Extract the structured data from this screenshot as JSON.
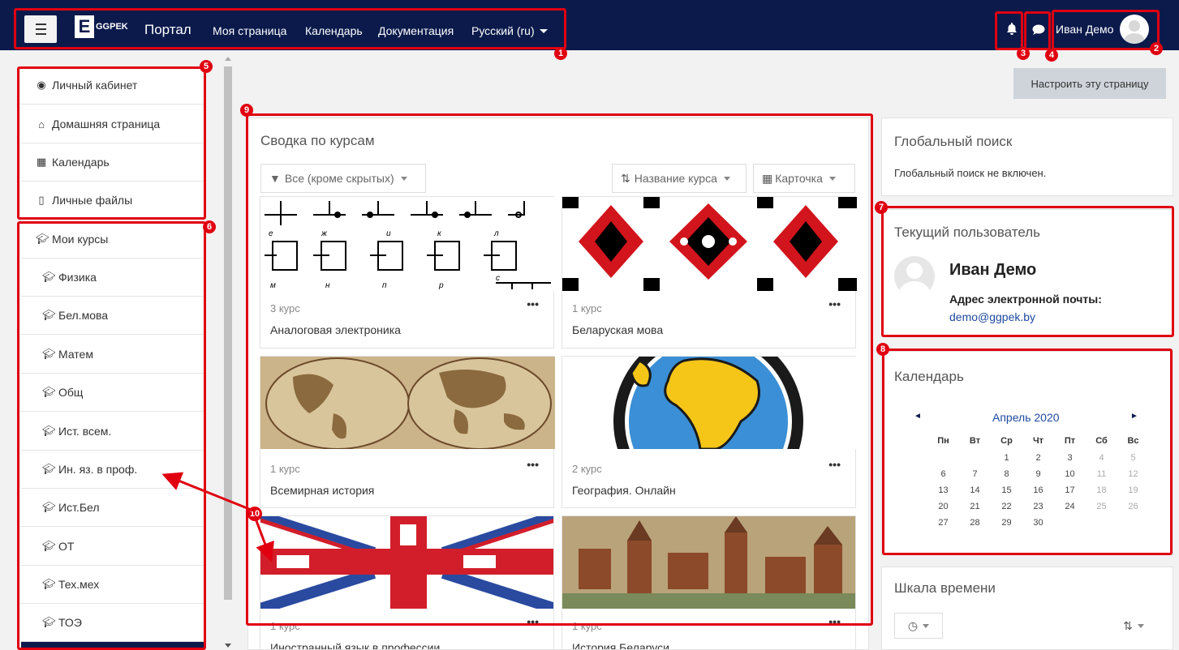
{
  "navbar": {
    "brand": "Портал",
    "logo_text": "GGPEK",
    "nav_items": [
      "Моя страница",
      "Календарь",
      "Документация"
    ],
    "lang": "Русский (ru)",
    "user_name": "Иван Демо"
  },
  "drawer": {
    "items": [
      {
        "label": "Личный кабинет",
        "icon": "dashboard-icon"
      },
      {
        "label": "Домашняя страница",
        "icon": "home-icon"
      },
      {
        "label": "Календарь",
        "icon": "calendar-icon"
      },
      {
        "label": "Личные файлы",
        "icon": "file-icon"
      },
      {
        "label": "Мои курсы",
        "icon": "graduation-cap-icon"
      },
      {
        "label": "Физика",
        "icon": "graduation-cap-icon"
      },
      {
        "label": "Бел.мова",
        "icon": "graduation-cap-icon"
      },
      {
        "label": "Матем",
        "icon": "graduation-cap-icon"
      },
      {
        "label": "Общ",
        "icon": "graduation-cap-icon"
      },
      {
        "label": "Ист. всем.",
        "icon": "graduation-cap-icon"
      },
      {
        "label": "Ин. яз. в проф.",
        "icon": "graduation-cap-icon"
      },
      {
        "label": "Ист.Бел",
        "icon": "graduation-cap-icon"
      },
      {
        "label": "ОТ",
        "icon": "graduation-cap-icon"
      },
      {
        "label": "Тех.мех",
        "icon": "graduation-cap-icon"
      },
      {
        "label": "ТОЭ",
        "icon": "graduation-cap-icon"
      }
    ]
  },
  "customize_button": "Настроить эту страницу",
  "overview": {
    "title": "Сводка по курсам",
    "filter": "Все (кроме скрытых)",
    "sort": "Название курса",
    "view": "Карточка",
    "courses": [
      {
        "level": "3 курс",
        "name": "Аналоговая электроника"
      },
      {
        "level": "1 курс",
        "name": "Беларуская мова"
      },
      {
        "level": "1 курс",
        "name": "Всемирная история"
      },
      {
        "level": "2 курс",
        "name": "География. Онлайн"
      },
      {
        "level": "1 курс",
        "name": "Иностранный язык в профессии"
      },
      {
        "level": "1 курс",
        "name": "История Беларуси"
      }
    ]
  },
  "search_block": {
    "title": "Глобальный поиск",
    "text": "Глобальный поиск не включен."
  },
  "user_block": {
    "title": "Текущий пользователь",
    "name": "Иван Демо",
    "email_label": "Адрес электронной почты:",
    "email": "demo@ggpek.by"
  },
  "calendar_block": {
    "title": "Календарь",
    "month": "Апрель 2020",
    "prev": "◄",
    "next": "►",
    "days": [
      "Пн",
      "Вт",
      "Ср",
      "Чт",
      "Пт",
      "Сб",
      "Вс"
    ],
    "weeks": [
      [
        "",
        "",
        "1",
        "2",
        "3",
        "4",
        "5"
      ],
      [
        "6",
        "7",
        "8",
        "9",
        "10",
        "11",
        "12"
      ],
      [
        "13",
        "14",
        "15",
        "16",
        "17",
        "18",
        "19"
      ],
      [
        "20",
        "21",
        "22",
        "23",
        "24",
        "25",
        "26"
      ],
      [
        "27",
        "28",
        "29",
        "30",
        "",
        "",
        ""
      ]
    ]
  },
  "timeline_block": {
    "title": "Шкала времени"
  },
  "annotations": [
    "1",
    "2",
    "3",
    "4",
    "5",
    "6",
    "7",
    "8",
    "9",
    "10"
  ],
  "colors": {
    "navbar": "#0b1a4b",
    "annotation": "#e00010",
    "link": "#1f4aa0"
  }
}
